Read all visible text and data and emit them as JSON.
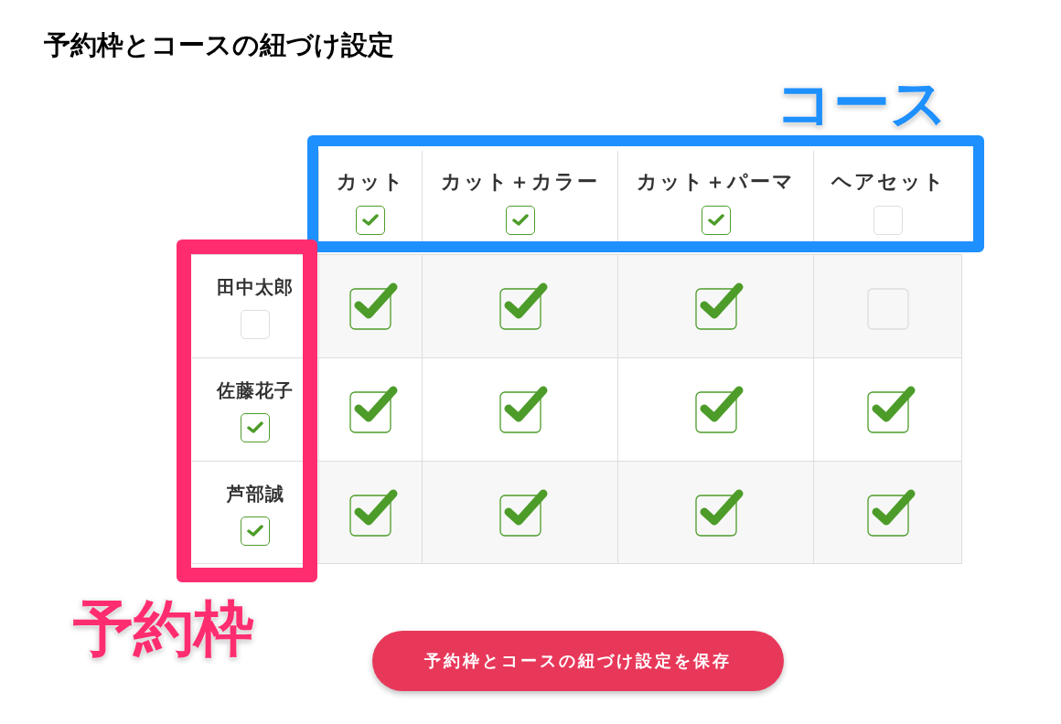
{
  "title": "予約枠とコースの紐づけ設定",
  "courses": [
    {
      "name": "カット",
      "checked": true
    },
    {
      "name": "カット＋カラー",
      "checked": true
    },
    {
      "name": "カット＋パーマ",
      "checked": true
    },
    {
      "name": "ヘアセット",
      "checked": false
    }
  ],
  "slots": [
    {
      "name": "田中太郎",
      "checked": false,
      "cells": [
        {
          "checked": true
        },
        {
          "checked": true
        },
        {
          "checked": true
        },
        {
          "checked": false
        }
      ]
    },
    {
      "name": "佐藤花子",
      "checked": true,
      "cells": [
        {
          "checked": true
        },
        {
          "checked": true
        },
        {
          "checked": true
        },
        {
          "checked": true
        }
      ]
    },
    {
      "name": "芦部誠",
      "checked": true,
      "cells": [
        {
          "checked": true
        },
        {
          "checked": true
        },
        {
          "checked": true
        },
        {
          "checked": true
        }
      ]
    }
  ],
  "annotations": [
    {
      "kind": "course",
      "label": "コース",
      "color": "#1e90ff"
    },
    {
      "kind": "slot",
      "label": "予約枠",
      "color": "#ff2d6f"
    }
  ],
  "save_button": "予約枠とコースの紐づけ設定を保存"
}
